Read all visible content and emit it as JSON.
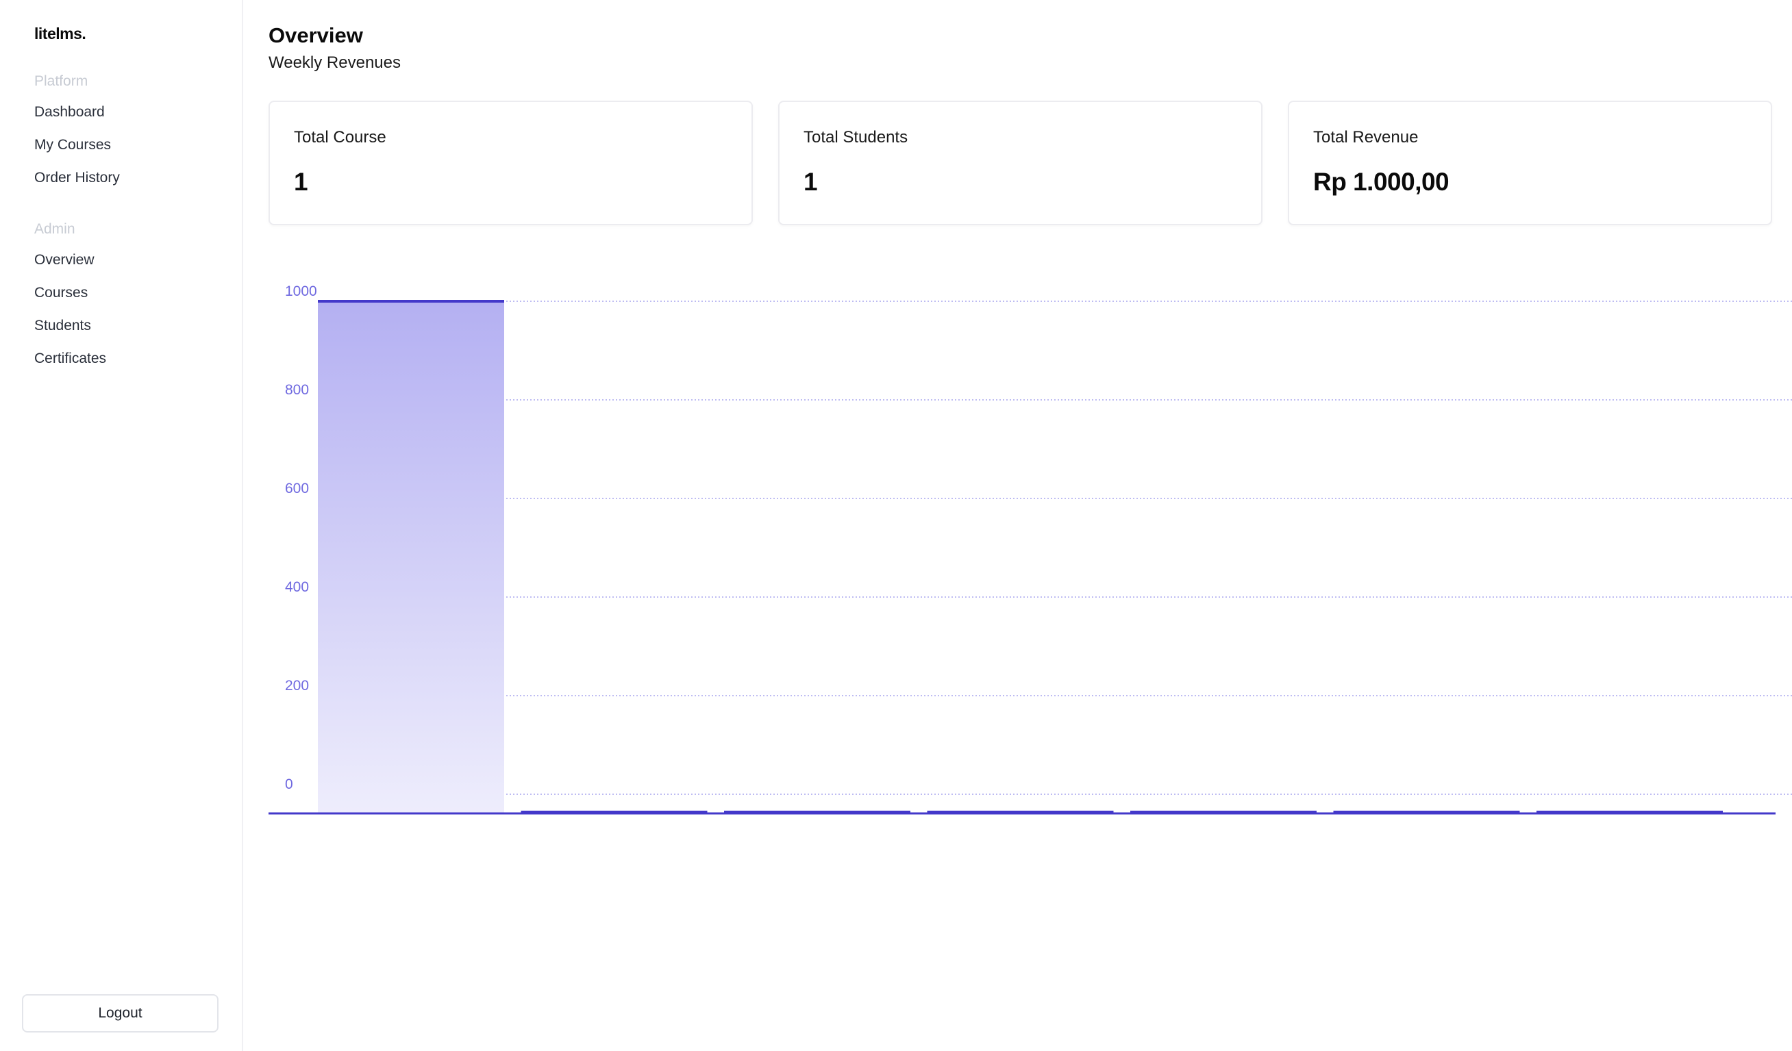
{
  "brand": "litelms.",
  "sidebar": {
    "platform_title": "Platform",
    "platform_items": [
      {
        "label": "Dashboard"
      },
      {
        "label": "My Courses"
      },
      {
        "label": "Order History"
      }
    ],
    "admin_title": "Admin",
    "admin_items": [
      {
        "label": "Overview"
      },
      {
        "label": "Courses"
      },
      {
        "label": "Students"
      },
      {
        "label": "Certificates"
      }
    ],
    "logout_label": "Logout"
  },
  "main": {
    "title": "Overview",
    "subtitle": "Weekly Revenues",
    "stats": [
      {
        "label": "Total Course",
        "value": "1"
      },
      {
        "label": "Total Students",
        "value": "1"
      },
      {
        "label": "Total Revenue",
        "value": "Rp 1.000,00"
      }
    ]
  },
  "colors": {
    "accent": "#4338ca",
    "bar_fill_top": "#b4b0f2",
    "bar_fill_bottom": "#eeedfc",
    "tick": "#6f69e0",
    "grid": "#a9a5ee"
  },
  "chart_data": {
    "type": "bar",
    "series": [
      {
        "values": [
          1000,
          0,
          0,
          0,
          0,
          0,
          0
        ]
      }
    ],
    "y_ticks": [
      0,
      200,
      400,
      600,
      800,
      1000
    ],
    "ylim": [
      0,
      1000
    ],
    "grid": true
  }
}
